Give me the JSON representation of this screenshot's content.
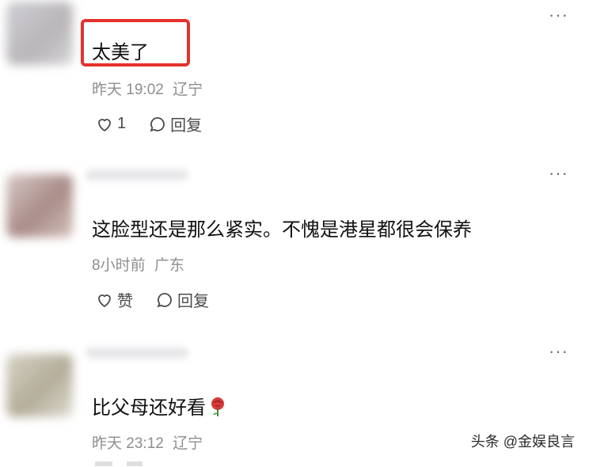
{
  "comments": [
    {
      "text": "太美了",
      "time": "昨天 19:02",
      "location": "辽宁",
      "like_label": "1",
      "reply_label": "回复"
    },
    {
      "text": "这脸型还是那么紧实。不愧是港星都很会保养",
      "time": "8小时前",
      "location": "广东",
      "like_label": "赞",
      "reply_label": "回复"
    },
    {
      "text": "比父母还好看",
      "time": "昨天 23:12",
      "location": "辽宁"
    }
  ],
  "more_label": "···",
  "watermark": "头条 @金娱良言",
  "icons": {
    "like": "heart-outline-icon",
    "reply": "comment-bubble-icon",
    "more": "more-dots-icon",
    "emoji": "rose-emoji-icon"
  },
  "colors": {
    "highlight_border": "#e5322d",
    "meta_text": "#8e8e8e",
    "body_text": "#111111"
  }
}
